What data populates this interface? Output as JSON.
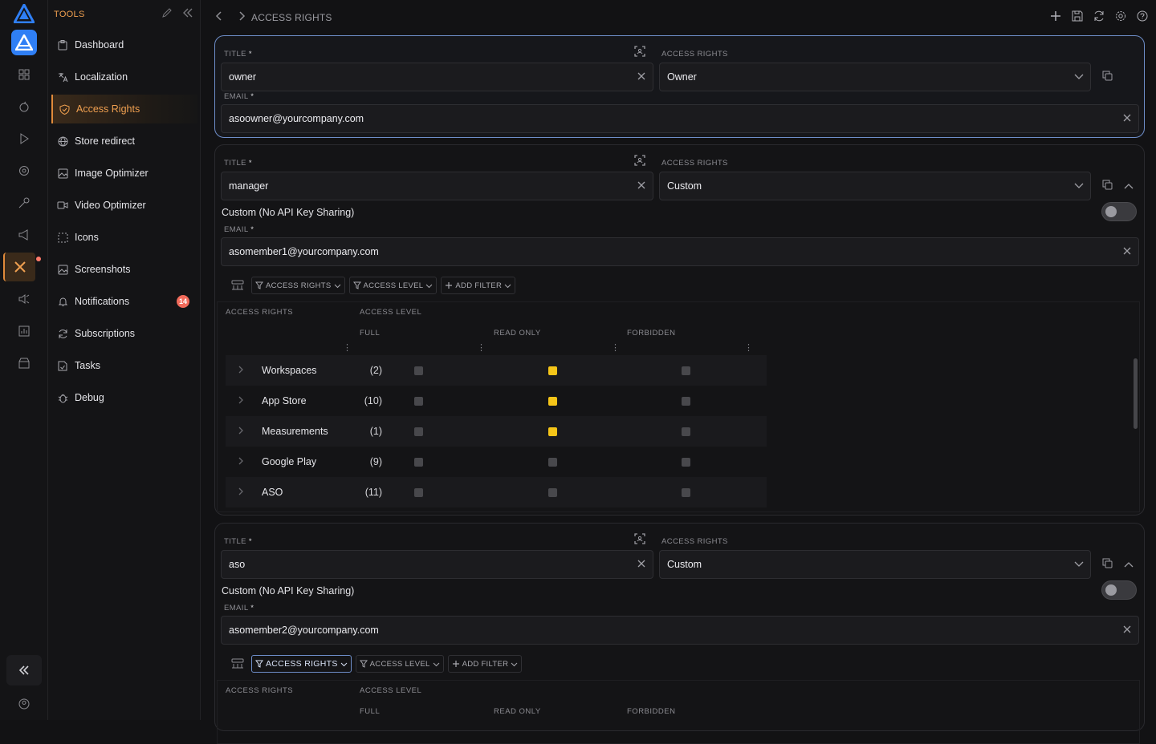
{
  "sidebar": {
    "header": "TOOLS",
    "items": [
      {
        "label": "Dashboard",
        "icon": "clipboard-icon"
      },
      {
        "label": "Localization",
        "icon": "translate-icon"
      },
      {
        "label": "Access Rights",
        "icon": "shield-icon"
      },
      {
        "label": "Store redirect",
        "icon": "globe-icon"
      },
      {
        "label": "Image Optimizer",
        "icon": "image-icon"
      },
      {
        "label": "Video Optimizer",
        "icon": "video-icon"
      },
      {
        "label": "Icons",
        "icon": "icons-icon"
      },
      {
        "label": "Screenshots",
        "icon": "screenshot-icon"
      },
      {
        "label": "Notifications",
        "icon": "bell-icon",
        "badge": "14"
      },
      {
        "label": "Subscriptions",
        "icon": "refresh-icon"
      },
      {
        "label": "Tasks",
        "icon": "task-icon"
      },
      {
        "label": "Debug",
        "icon": "bug-icon"
      }
    ]
  },
  "header": {
    "breadcrumb": "ACCESS RIGHTS"
  },
  "labels": {
    "title": "TITLE",
    "email": "EMAIL",
    "access_rights": "ACCESS RIGHTS",
    "access_level": "ACCESS LEVEL",
    "full": "FULL",
    "read_only": "READ ONLY",
    "forbidden": "FORBIDDEN",
    "required": "*",
    "filter_access_rights": "ACCESS RIGHTS",
    "filter_access_level": "ACCESS LEVEL",
    "add_filter": "ADD FILTER",
    "toggle_label": "Custom (No API Key Sharing)"
  },
  "members": [
    {
      "title": "owner",
      "access": "Owner",
      "email": "asoowner@yourcompany.com"
    },
    {
      "title": "manager",
      "access": "Custom",
      "email": "asomember1@yourcompany.com"
    },
    {
      "title": "aso",
      "access": "Custom",
      "email": "asomember2@yourcompany.com"
    }
  ],
  "rights_table": [
    {
      "name": "Workspaces",
      "count": "(2)",
      "level": "read_only"
    },
    {
      "name": "App Store",
      "count": "(10)",
      "level": "read_only"
    },
    {
      "name": "Measurements",
      "count": "(1)",
      "level": "read_only"
    },
    {
      "name": "Google Play",
      "count": "(9)",
      "level": "none"
    },
    {
      "name": "ASO",
      "count": "(11)",
      "level": "none"
    }
  ],
  "colors": {
    "accent": "#f0a050",
    "checked": "#f5c518",
    "selected_border": "#6e8ec9",
    "badge": "#f26b5b"
  }
}
